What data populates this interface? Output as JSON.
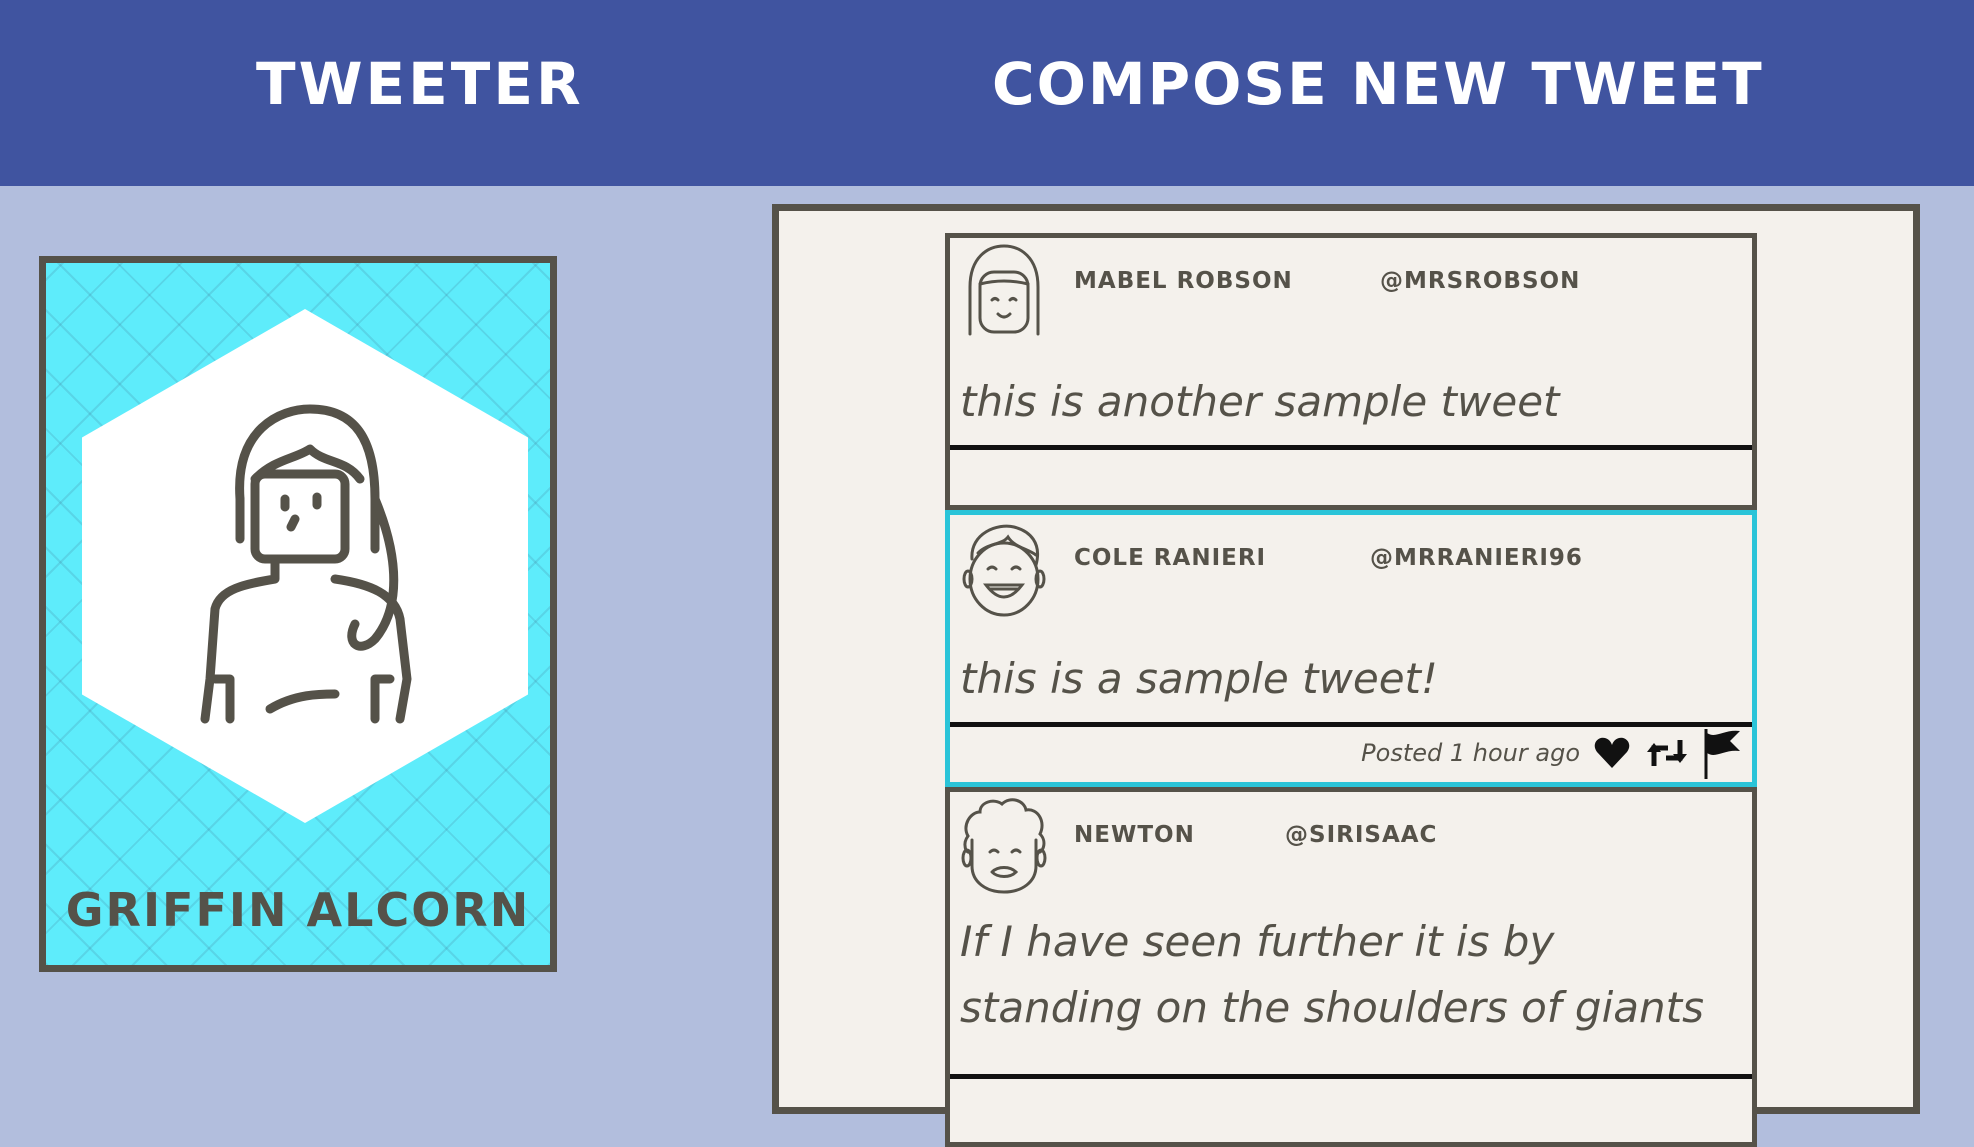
{
  "header": {
    "brand": "Tweeter",
    "compose": "Compose New Tweet"
  },
  "profile": {
    "name": "Griffin Alcorn",
    "avatar_icon": "woman-avatar-icon",
    "card_color": "#5eecfb"
  },
  "tweets": [
    {
      "name": "Mabel Robson",
      "handle": "@mrsrobson",
      "text": "this is another sample tweet",
      "avatar_icon": "smiling-girl-avatar-icon"
    },
    {
      "name": "Cole Ranieri",
      "handle": "@mrranieri96",
      "text": "this is a sample tweet!",
      "posted": "Posted 1 hour ago",
      "avatar_icon": "laughing-boy-avatar-icon",
      "actions": [
        "heart-icon",
        "retweet-icon",
        "flag-icon"
      ]
    },
    {
      "name": "Newton",
      "handle": "@sirisaac",
      "text": "If I have seen further it is by standing on the shoulders of giants",
      "avatar_icon": "curly-hair-man-avatar-icon"
    }
  ],
  "colors": {
    "navbar": "#4054a0",
    "background": "#b2bedd",
    "active_border": "#2ac4d8",
    "text": "#555249"
  }
}
